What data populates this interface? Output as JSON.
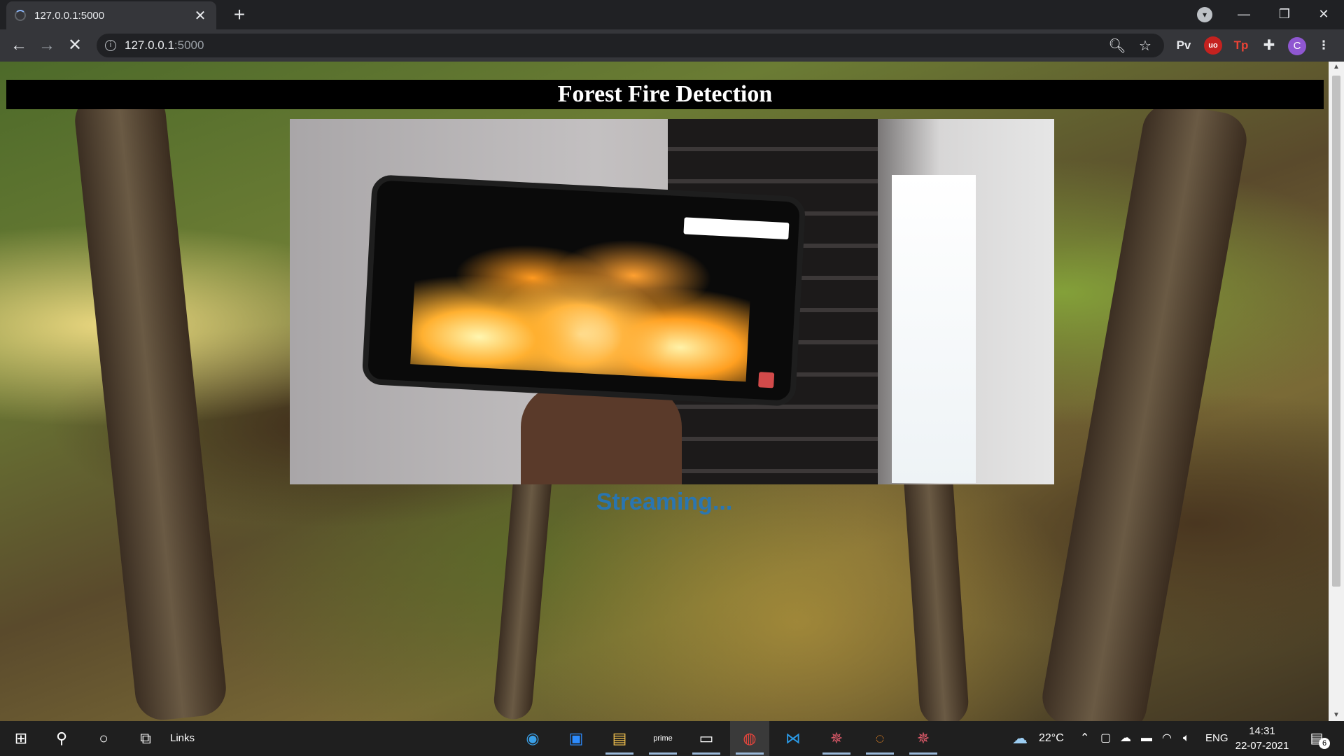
{
  "browser": {
    "tab_title": "127.0.0.1:5000",
    "tab_close": "✕",
    "new_tab": "+",
    "url_host": "127.0.0.1",
    "url_port": ":5000",
    "extensions": {
      "pv": "Pv",
      "ublock": "uo",
      "tp": "Tp",
      "profile_initial": "C"
    }
  },
  "page": {
    "heading": "Forest Fire Detection",
    "status": "Streaming..."
  },
  "taskbar": {
    "links_label": "Links",
    "weather": "22°C",
    "language": "ENG",
    "time": "14:31",
    "date": "22-07-2021",
    "notification_count": "6"
  },
  "colors": {
    "chrome_dark": "#202124",
    "chrome_toolbar": "#35363a",
    "header_bar": "#000000",
    "status_text": "#1e78c8",
    "taskbar": "#1f1f1f"
  }
}
